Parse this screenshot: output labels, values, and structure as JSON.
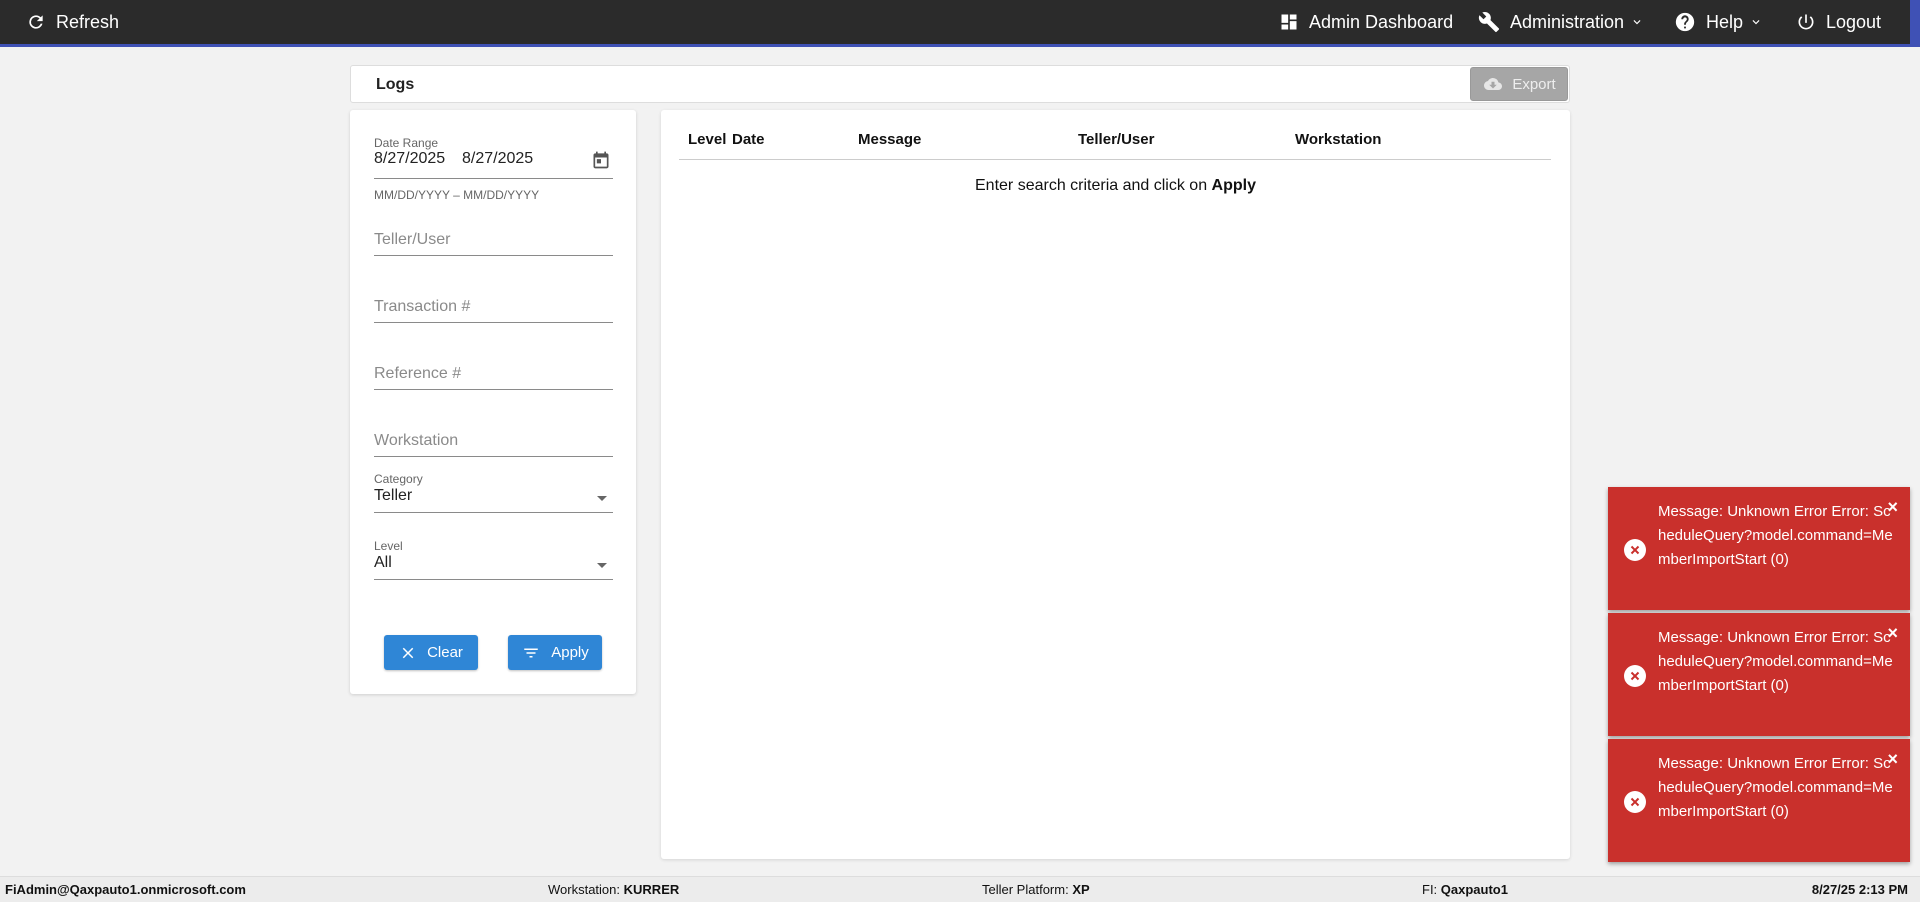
{
  "topbar": {
    "refresh_label": "Refresh",
    "admin_dashboard_label": "Admin Dashboard",
    "administration_label": "Administration",
    "help_label": "Help",
    "logout_label": "Logout"
  },
  "logs": {
    "title": "Logs",
    "export_label": "Export"
  },
  "filters": {
    "date_range_label": "Date Range",
    "date_start": "8/27/2025",
    "date_end": "8/27/2025",
    "date_hint": "MM/DD/YYYY – MM/DD/YYYY",
    "teller_user_placeholder": "Teller/User",
    "transaction_placeholder": "Transaction #",
    "reference_placeholder": "Reference #",
    "workstation_placeholder": "Workstation",
    "category_label": "Category",
    "category_value": "Teller",
    "level_label": "Level",
    "level_value": "All",
    "clear_label": "Clear",
    "apply_label": "Apply"
  },
  "results": {
    "columns": [
      "Level",
      "Date",
      "Message",
      "Teller/User",
      "Workstation"
    ],
    "empty_prefix": "Enter search criteria and click on ",
    "empty_action": "Apply"
  },
  "toasts": [
    {
      "message": "Message: Unknown Error Error: ScheduleQuery?model.command=MemberImportStart (0)",
      "close": "×"
    },
    {
      "message": "Message: Unknown Error Error: ScheduleQuery?model.command=MemberImportStart (0)",
      "close": "×"
    },
    {
      "message": "Message: Unknown Error Error: ScheduleQuery?model.command=MemberImportStart (0)",
      "close": "×"
    }
  ],
  "statusbar": {
    "user": "FiAdmin@Qaxpauto1.onmicrosoft.com",
    "workstation_label": "Workstation:",
    "workstation_value": "KURRER",
    "platform_label": "Teller Platform:",
    "platform_value": "XP",
    "fi_label": "FI:",
    "fi_value": "Qaxpauto1",
    "datetime": "8/27/25 2:13 PM"
  },
  "colors": {
    "topbar_bg": "#2b2b2b",
    "accent": "#3f51b5",
    "button_blue": "#2f86d6",
    "toast_red": "#c9302c",
    "export_disabled": "#a6a6a6"
  },
  "icons": {
    "refresh": "refresh-icon",
    "dashboard": "dashboard-icon",
    "administration": "wrench-icon",
    "help": "help-circle-icon",
    "logout": "power-icon",
    "export": "cloud-download-icon",
    "calendar": "calendar-icon",
    "clear": "close-icon",
    "apply": "filter-icon",
    "toast": "error-circle-icon"
  }
}
